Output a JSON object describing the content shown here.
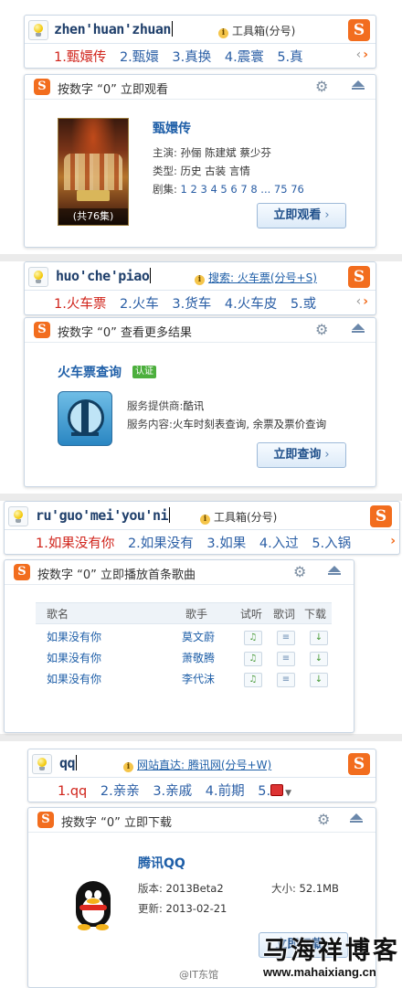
{
  "blocks": [
    {
      "pinyin": "zhen'huan'zhuan",
      "hint": "工具箱(分号)",
      "candidates": [
        "1.甄嬛传",
        "2.甄嬛",
        "3.真换",
        "4.震寰",
        "5.真"
      ],
      "panel_title": "按数字 “0” 立即观看",
      "title": "甄嬛传",
      "meta": [
        {
          "label": "主演:",
          "value": "孙俪  陈建斌  蔡少芬"
        },
        {
          "label": "类型:",
          "value": "历史  古装  言情"
        },
        {
          "label": "剧集:",
          "value": "1  2  3  4  5  6  7  8  ...  75  76"
        }
      ],
      "poster_count": "(共76集)",
      "button": "立即观看"
    },
    {
      "pinyin": "huo'che'piao",
      "hint": "搜索: 火车票(分号+S)",
      "candidates": [
        "1.火车票",
        "2.火车",
        "3.货车",
        "4.火车皮",
        "5.或"
      ],
      "panel_title": "按数字 “0” 查看更多结果",
      "title": "火车票查询",
      "badge": "认证",
      "meta": [
        {
          "label": "服务提供商:",
          "value": "酷讯"
        },
        {
          "label": "服务内容:",
          "value": "火车时刻表查询, 余票及票价查询"
        }
      ],
      "button": "立即查询"
    },
    {
      "pinyin": "ru'guo'mei'you'ni",
      "hint": "工具箱(分号)",
      "candidates": [
        "1.如果没有你",
        "2.如果没有",
        "3.如果",
        "4.入过",
        "5.入锅"
      ],
      "panel_title": "按数字 “0” 立即播放首条歌曲",
      "columns": [
        "歌名",
        "歌手",
        "试听",
        "歌词",
        "下载"
      ],
      "songs": [
        {
          "name": "如果没有你",
          "singer": "莫文蔚"
        },
        {
          "name": "如果没有你",
          "singer": "萧敬腾"
        },
        {
          "name": "如果没有你",
          "singer": "李代沫"
        }
      ]
    },
    {
      "pinyin": "qq",
      "hint": "网站直达: 腾讯网(分号+W)",
      "candidates": [
        "1.qq",
        "2.亲亲",
        "3.亲戚",
        "4.前期",
        "5."
      ],
      "panel_title": "按数字 “0” 立即下载",
      "title": "腾讯QQ",
      "meta": [
        {
          "label": "版本:",
          "value": "2013Beta2"
        },
        {
          "label": "更新:",
          "value": "2013-02-21"
        }
      ],
      "size_label": "大小:",
      "size_value": "52.1MB",
      "button": "立即下载"
    }
  ],
  "watermark": {
    "site_cn": "马海祥博客",
    "site_url": "www.mahaixiang.cn",
    "weibo": "@IT东馆"
  },
  "colors": {
    "accent_orange": "#f26d1e",
    "candidate_first": "#d0231a",
    "candidate": "#2a5ea5",
    "link": "#1f5fa8"
  }
}
